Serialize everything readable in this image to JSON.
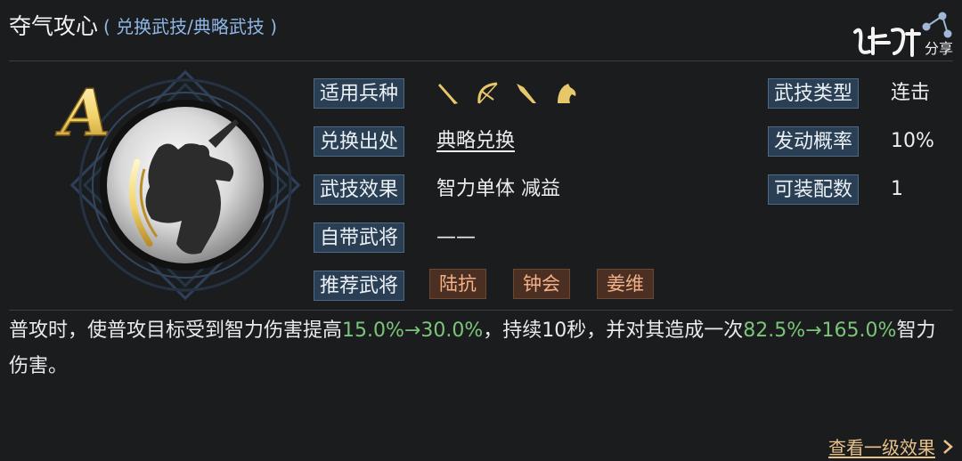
{
  "header": {
    "title": "夺气攻心",
    "subtitle": "( 兑换武技/典略武技 )"
  },
  "watermark": {
    "text": "分享"
  },
  "skill": {
    "grade": "A",
    "rows": [
      {
        "label": "适用兵种",
        "type": "icons",
        "icons": [
          "spear-icon",
          "bow-icon",
          "lance-icon",
          "horse-icon"
        ]
      },
      {
        "label": "兑换出处",
        "value": "典略兑换"
      },
      {
        "label": "武技效果",
        "value": "智力单体 减益"
      },
      {
        "label": "自带武将",
        "value": "——"
      },
      {
        "label": "推荐武将",
        "tags": [
          "陆抗",
          "钟会",
          "姜维"
        ]
      }
    ],
    "right_rows": [
      {
        "label": "武技类型",
        "value": "连击"
      },
      {
        "label": "发动概率",
        "value": "10%"
      },
      {
        "label": "可装配数",
        "value": "1"
      }
    ]
  },
  "description": {
    "part1": "普攻时，使普攻目标受到智力伤害提高",
    "hl1": "15.0%→30.0%",
    "part2": "，持续10秒，并对其造成一次",
    "hl2": "82.5%→165.0%",
    "part3": "智力伤害。"
  },
  "footer": {
    "link_label": "查看一级效果"
  },
  "colors": {
    "highlight_green": "#7cc47a",
    "tag_text": "#f4b187",
    "link_gold": "#e8c289",
    "subtitle_blue": "#8fb6e6"
  }
}
